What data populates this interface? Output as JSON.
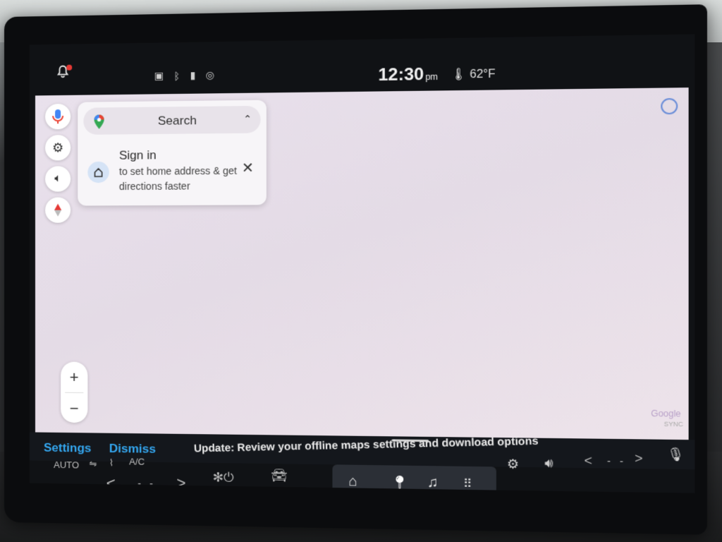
{
  "status_bar": {
    "time": "12:30",
    "ampm": "pm",
    "temperature": "62°F",
    "icons": [
      "bell-icon",
      "message-icon",
      "bluetooth-icon",
      "phone-icon",
      "power-icon",
      "thermometer-icon"
    ]
  },
  "map": {
    "search_label": "Search",
    "signin_title": "Sign in",
    "signin_body": "to set home address & get directions faster",
    "attribution": "Google",
    "side_buttons": [
      "mic-icon",
      "settings-icon",
      "volume-icon",
      "compass-icon"
    ],
    "zoom_in": "+",
    "zoom_out": "−"
  },
  "notification": {
    "settings_label": "Settings",
    "dismiss_label": "Dismiss",
    "update_text": "Update: Review your offline maps settings and download options",
    "sync_label": "SYNC"
  },
  "climate": {
    "auto_label": "AUTO",
    "ac_label": "A/C",
    "temp_left": "- -",
    "temp_right": "- -"
  },
  "dock": {
    "apps": [
      "home-icon",
      "maps-icon",
      "music-icon",
      "apps-grid-icon"
    ],
    "active": "maps-icon"
  },
  "colors": {
    "accent": "#34a7f0",
    "map_bg": "#e8e0ea",
    "screen_bg": "#101215"
  }
}
